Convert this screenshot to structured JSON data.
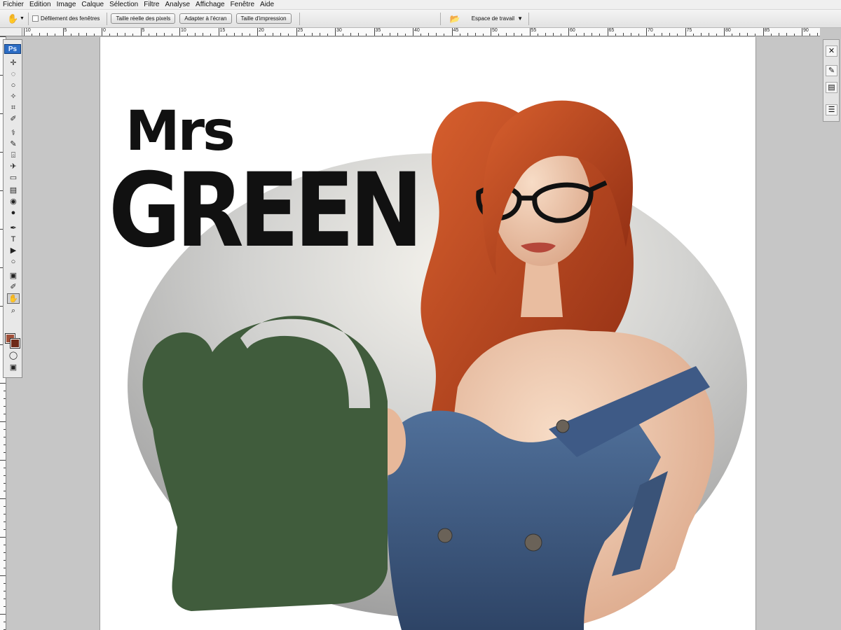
{
  "menu": [
    "Fichier",
    "Edition",
    "Image",
    "Calque",
    "Sélection",
    "Filtre",
    "Analyse",
    "Affichage",
    "Fenêtre",
    "Aide"
  ],
  "options": {
    "scroll_all_label": "Défilement des fenêtres",
    "actual_pixels": "Taille réelle des pixels",
    "fit_screen": "Adapter à l'écran",
    "print_size": "Taille d'impression",
    "workspace": "Espace de travail"
  },
  "toolbox": {
    "logo": "Ps",
    "tools": [
      "move-tool",
      "marquee-tool",
      "lasso-tool",
      "magic-wand-tool",
      "crop-tool",
      "eyedropper-tool",
      "healing-brush-tool",
      "brush-tool",
      "clone-stamp-tool",
      "history-brush-tool",
      "eraser-tool",
      "gradient-tool",
      "blur-tool",
      "dodge-tool",
      "pen-tool",
      "type-tool",
      "path-selection-tool",
      "shape-tool",
      "notes-tool",
      "eyedropper-tool-2",
      "hand-tool",
      "zoom-tool"
    ],
    "foreground_color": "#a0503a",
    "background_color": "#6e2a18"
  },
  "rulers": {
    "top_labels": [
      "10",
      "5",
      "0",
      "5",
      "10",
      "15",
      "20",
      "25",
      "30",
      "35",
      "40",
      "45",
      "50",
      "55",
      "60",
      "65",
      "70",
      "75",
      "80",
      "85",
      "90"
    ]
  },
  "artwork": {
    "title_line1": "Mrs",
    "title_line2": "GREEN",
    "watering_can_color": "#405c3c",
    "ellipse_color": "#b4b4b4",
    "hair_color": "#b8421e",
    "overalls_color": "#3f5a82"
  }
}
